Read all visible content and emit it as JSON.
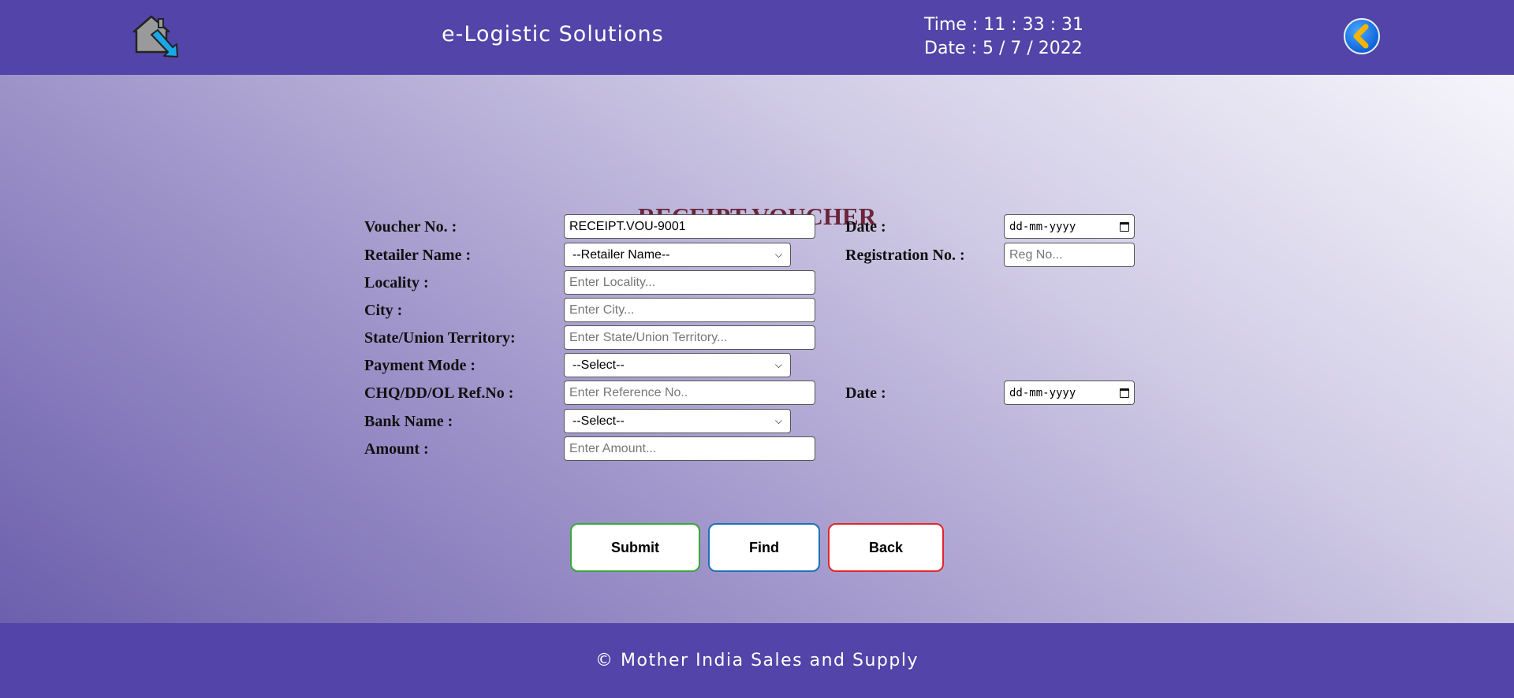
{
  "header": {
    "home_icon": "home-arrow-icon",
    "title": "e-Logistic Solutions",
    "time": "Time : 11 : 33 : 31",
    "date": "Date : 5 / 7 / 2022",
    "back_icon": "chevron-left-circle-icon"
  },
  "form": {
    "title": "RECEIPT VOUCHER",
    "voucher_no": {
      "label": "Voucher No. :",
      "value": "RECEIPT.VOU-9001"
    },
    "date": {
      "label": "Date :",
      "placeholder": "dd-mm-yyyy"
    },
    "retailer": {
      "label": "Retailer Name :",
      "selected": "--Retailer Name--"
    },
    "registration": {
      "label": "Registration No. :",
      "placeholder": "Reg No..."
    },
    "locality": {
      "label": "Locality :",
      "placeholder": "Enter Locality..."
    },
    "city": {
      "label": "City :",
      "placeholder": "Enter City..."
    },
    "state": {
      "label": "State/Union Territory:",
      "placeholder": "Enter State/Union Territory..."
    },
    "payment_mode": {
      "label": "Payment Mode :",
      "selected": "--Select--"
    },
    "reference": {
      "label": "CHQ/DD/OL Ref.No :",
      "placeholder": "Enter Reference No.."
    },
    "ref_date": {
      "label": "Date :",
      "placeholder": "dd-mm-yyyy"
    },
    "bank": {
      "label": "Bank Name :",
      "selected": "--Select--"
    },
    "amount": {
      "label": "Amount :",
      "placeholder": "Enter Amount..."
    }
  },
  "buttons": {
    "submit": "Submit",
    "find": "Find",
    "back": "Back"
  },
  "colors": {
    "header_bg": "#5244a8",
    "title": "#6b2438",
    "submit_border": "#3aa63a",
    "find_border": "#1f6fb8",
    "back_border": "#e0252b"
  },
  "footer": {
    "text": "© Mother India Sales and Supply"
  }
}
